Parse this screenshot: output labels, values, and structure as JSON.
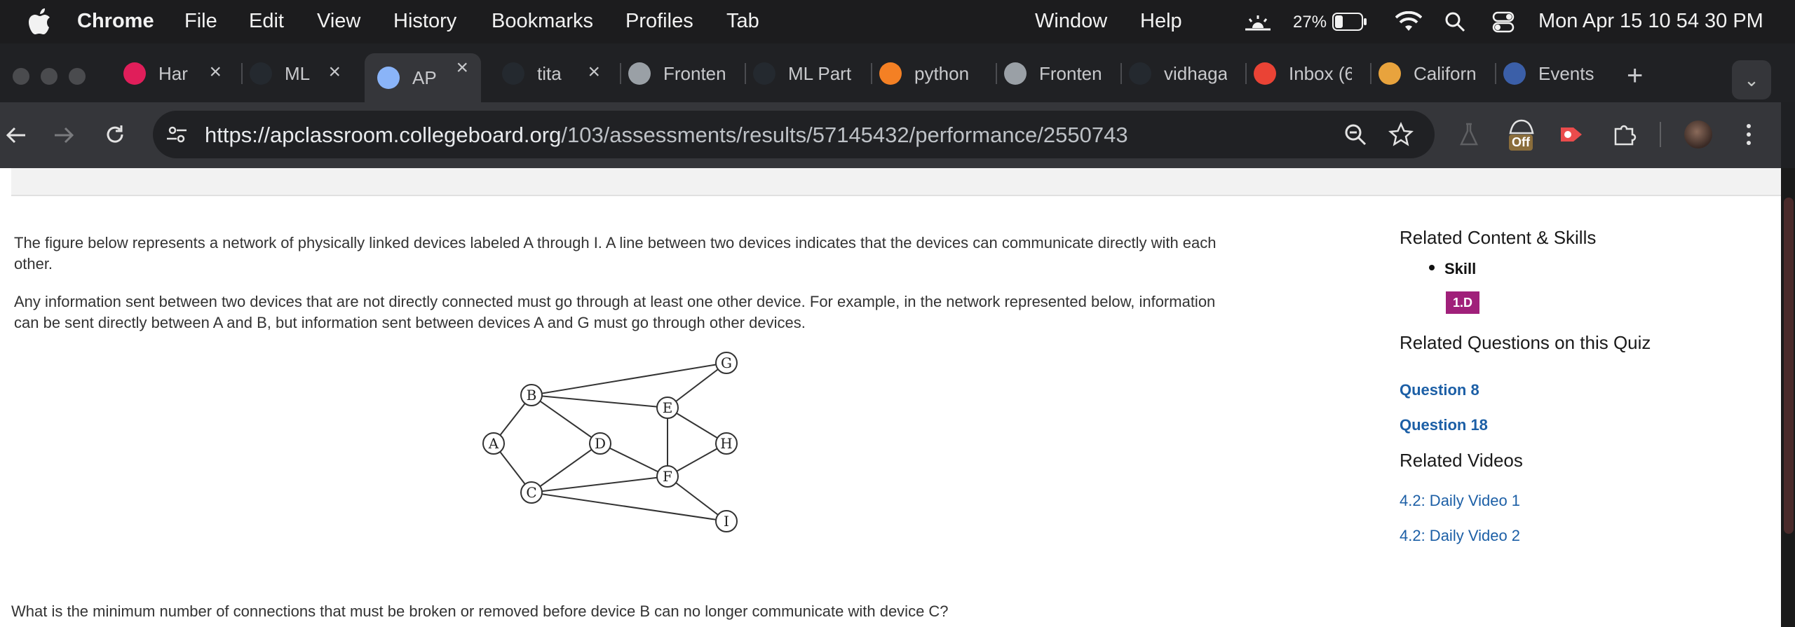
{
  "menubar": {
    "app": "Chrome",
    "items": [
      "File",
      "Edit",
      "View",
      "History",
      "Bookmarks",
      "Profiles",
      "Tab",
      "Window",
      "Help"
    ],
    "battery": "27%",
    "datetime": "Mon Apr 15  10 54 30 PM"
  },
  "tabs": [
    {
      "title": "Har",
      "icon": "slack-icon",
      "color": "#e01e5a"
    },
    {
      "title": "ML",
      "icon": "github-icon",
      "color": "#24292f"
    },
    {
      "title": "AP",
      "icon": "globe-icon",
      "color": "#8ab4f8",
      "active": true
    },
    {
      "title": "tita",
      "icon": "github-icon",
      "color": "#24292f"
    },
    {
      "title": "Fronten",
      "icon": "web-icon",
      "color": "#9aa0a6"
    },
    {
      "title": "ML Part",
      "icon": "github-icon",
      "color": "#24292f"
    },
    {
      "title": "python",
      "icon": "stackoverflow-icon",
      "color": "#f48024"
    },
    {
      "title": "Fronten",
      "icon": "web-icon",
      "color": "#9aa0a6"
    },
    {
      "title": "vidhaga",
      "icon": "github-icon",
      "color": "#24292f"
    },
    {
      "title": "Inbox (6",
      "icon": "gmail-icon",
      "color": "#ea4335"
    },
    {
      "title": "Californ",
      "icon": "graduation-cap-icon",
      "color": "#e8a33d"
    },
    {
      "title": "Events",
      "icon": "seal-icon",
      "color": "#3b5fa8"
    }
  ],
  "omnibox": {
    "host": "https://apclassroom.collegeboard.org",
    "path": "/103/assessments/results/57145432/performance/2550743"
  },
  "extension_badge": "Off",
  "question": {
    "para1": "The figure below represents a network of physically linked devices labeled A through I. A line between two devices indicates that the devices can communicate directly with each other.",
    "para2": "Any information sent between two devices that are not directly connected must go through at least one other device. For example, in the network represented below, information can be sent directly between A and B, but information sent between devices A and G must go through other devices.",
    "prompt": "What is the minimum number of connections that must be broken or removed before device B can no longer communicate with device C?"
  },
  "network": {
    "nodes": [
      "A",
      "B",
      "C",
      "D",
      "E",
      "F",
      "G",
      "H",
      "I"
    ],
    "edges": [
      [
        "A",
        "B"
      ],
      [
        "A",
        "C"
      ],
      [
        "B",
        "D"
      ],
      [
        "B",
        "E"
      ],
      [
        "B",
        "G"
      ],
      [
        "C",
        "D"
      ],
      [
        "C",
        "F"
      ],
      [
        "C",
        "I"
      ],
      [
        "D",
        "F"
      ],
      [
        "E",
        "F"
      ],
      [
        "E",
        "G"
      ],
      [
        "E",
        "H"
      ],
      [
        "F",
        "H"
      ],
      [
        "F",
        "I"
      ]
    ]
  },
  "sidebar": {
    "related_title": "Related Content & Skills",
    "skill_label": "Skill",
    "skill_badge": "1.D",
    "skill_badge_color": "#a0207a",
    "questions_title": "Related Questions on this Quiz",
    "questions": [
      "Question 8",
      "Question 18"
    ],
    "videos_title": "Related Videos",
    "videos": [
      "4.2: Daily Video 1",
      "4.2: Daily Video 2"
    ]
  }
}
